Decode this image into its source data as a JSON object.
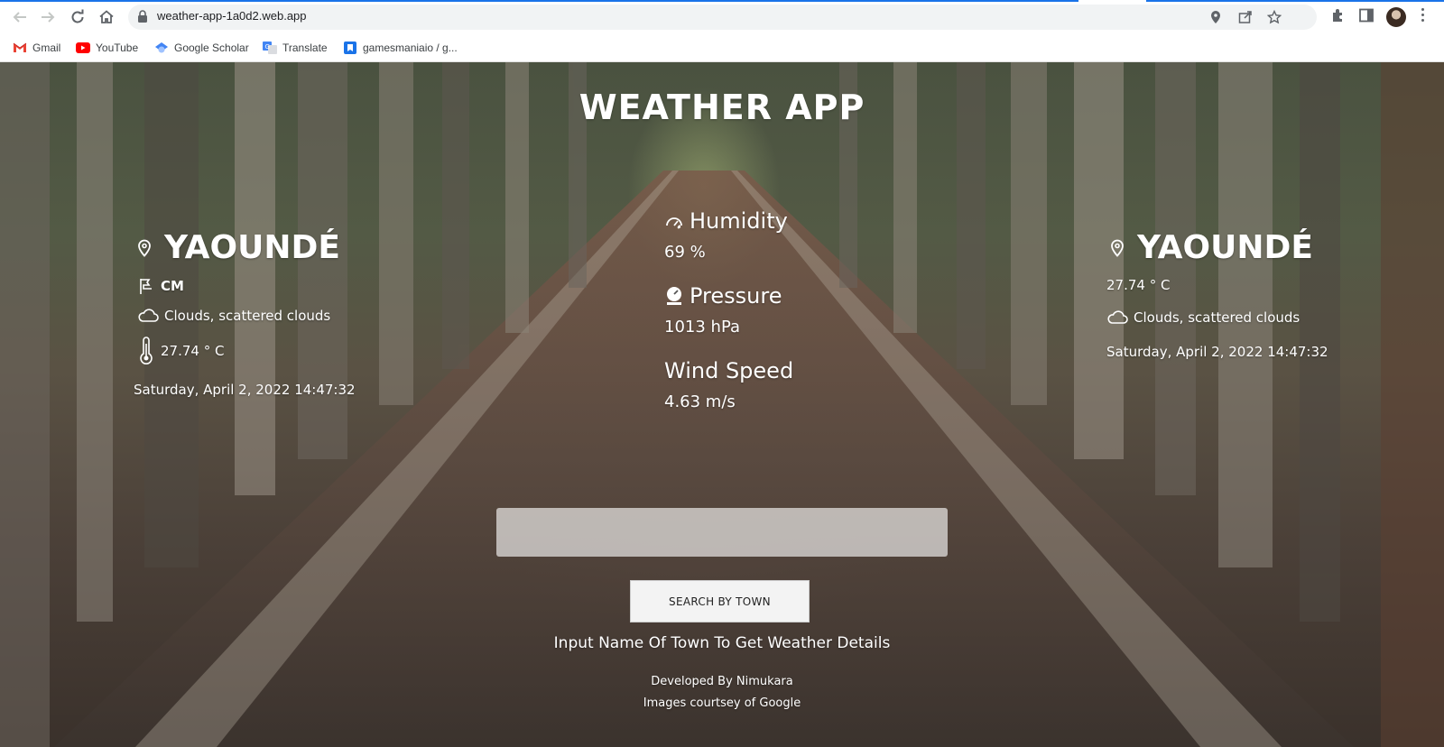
{
  "browser": {
    "url": "weather-app-1a0d2.web.app",
    "bookmarks": [
      {
        "label": "Gmail",
        "icon": "gmail-icon"
      },
      {
        "label": "YouTube",
        "icon": "youtube-icon"
      },
      {
        "label": "Google Scholar",
        "icon": "scholar-icon"
      },
      {
        "label": "Translate",
        "icon": "translate-icon"
      },
      {
        "label": "gamesmaniaio / g...",
        "icon": "bookmark-icon"
      }
    ]
  },
  "app": {
    "title": "WEATHER APP"
  },
  "left_panel": {
    "city": "YAOUNDÉ",
    "country": "CM",
    "condition": "Clouds, scattered clouds",
    "temperature": "27.74 ° C",
    "datetime": "Saturday, April 2, 2022 14:47:32"
  },
  "center_panel": {
    "humidity_label": "Humidity",
    "humidity_value": "69 %",
    "pressure_label": "Pressure",
    "pressure_value": "1013 hPa",
    "wind_label": "Wind Speed",
    "wind_value": "4.63 m/s"
  },
  "right_panel": {
    "city": "YAOUNDÉ",
    "temperature": "27.74 ° C",
    "condition": "Clouds, scattered clouds",
    "datetime": "Saturday, April 2, 2022 14:47:32"
  },
  "search": {
    "value": "",
    "button_label": "SEARCH BY TOWN",
    "hint": "Input Name Of Town To Get Weather Details"
  },
  "footer": {
    "developer": "Developed By Nimukara",
    "images_credit": "Images courtsey of Google"
  },
  "colors": {
    "accent": "#1a73e8",
    "text_on_image": "#ffffff"
  }
}
